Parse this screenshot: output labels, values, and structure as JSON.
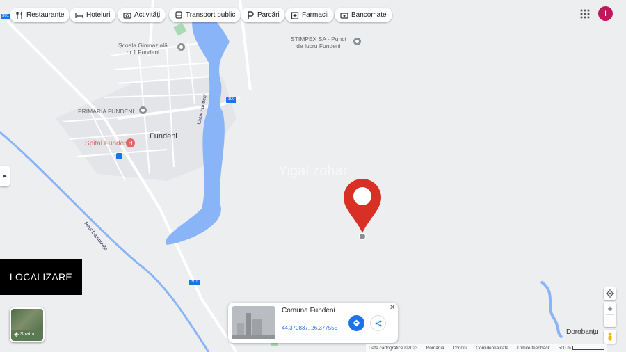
{
  "filters": [
    {
      "label": "Restaurante",
      "icon": "fork-knife-icon"
    },
    {
      "label": "Hoteluri",
      "icon": "bed-icon"
    },
    {
      "label": "Activități",
      "icon": "camera-icon"
    },
    {
      "label": "Transport public",
      "icon": "bus-icon"
    },
    {
      "label": "Parcări",
      "icon": "parking-icon"
    },
    {
      "label": "Farmacii",
      "icon": "pharmacy-icon"
    },
    {
      "label": "Bancomate",
      "icon": "atm-icon"
    }
  ],
  "user": {
    "initial": "I",
    "color": "#c2185b"
  },
  "places": {
    "school": "Școala Gimnazială\nnr.1 Fundeni",
    "stimpex": "STIMPEX SA - Punct\nde lucru Fundeni",
    "primaria": "PRIMARIA FUNDENI",
    "fundeni": "Fundeni",
    "spital": "Spital Fundeni",
    "lacul": "Lacul Fundeni",
    "raul": "Râul Dâmbovița",
    "dorobantu": "Dorobanțu",
    "watermark": "Yigal zohar"
  },
  "roads": {
    "r100": "100",
    "r301a": "301",
    "r301b": "301"
  },
  "banner": "LOCALIZARE",
  "card": {
    "title": "Comuna Fundeni",
    "coords": "44.370837, 26.377555"
  },
  "layers_label": "Straturi",
  "footer": {
    "data": "Date cartografice ©2023",
    "country": "România",
    "terms": "Condiții",
    "privacy": "Confidențialitate",
    "feedback": "Trimite feedback",
    "scale": "500 m"
  },
  "colors": {
    "water": "#8ab4f8",
    "pin": "#d93025",
    "hospital": "#e06666",
    "road": "#ffffff"
  }
}
